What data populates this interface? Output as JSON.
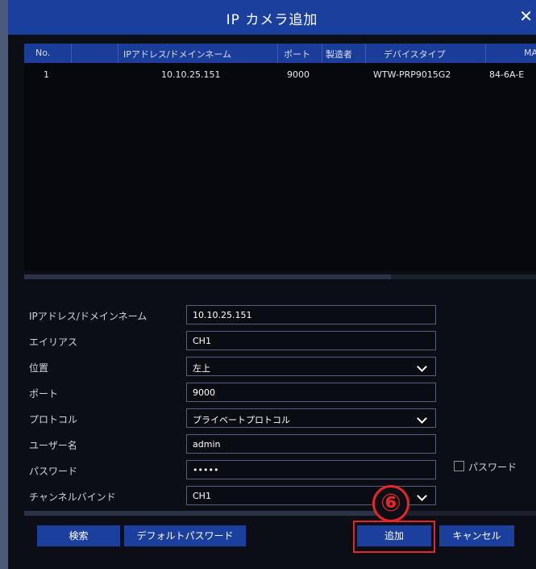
{
  "dialog": {
    "title": "IP カメラ追加",
    "close_glyph": "✕",
    "close_icon": "close-icon"
  },
  "table": {
    "columns": [
      "No.",
      "IPアドレス/ドメインネーム",
      "ポート",
      "製造者",
      "デバイスタイプ",
      "MAC"
    ],
    "rows": [
      {
        "no": "1",
        "ip": "10.10.25.151",
        "port": "9000",
        "manufacturer": "",
        "device_type": "WTW-PRP9015G2",
        "mac": "84-6A-E"
      }
    ]
  },
  "form": {
    "ip_label": "IPアドレス/ドメインネーム",
    "ip_value": "10.10.25.151",
    "alias_label": "エイリアス",
    "alias_value": "CH1",
    "position_label": "位置",
    "position_value": "左上",
    "port_label": "ポート",
    "port_value": "9000",
    "protocol_label": "プロトコル",
    "protocol_value": "プライベートプロトコル",
    "username_label": "ユーザー名",
    "username_value": "admin",
    "password_label": "パスワード",
    "password_value": "•••••",
    "show_password_label": "パスワード",
    "show_password_checked": false,
    "channel_label": "チャンネルバインド",
    "channel_value": "CH1"
  },
  "buttons": {
    "search": "検索",
    "default_password": "デフォルトパスワード",
    "add": "追加",
    "cancel": "キャンセル"
  },
  "annotation": {
    "step_marker": "⑥",
    "color": "#e8262a"
  },
  "colors": {
    "titlebar": "#1a3f9c",
    "button": "#1b3f9c",
    "background": "#0c0e16"
  }
}
